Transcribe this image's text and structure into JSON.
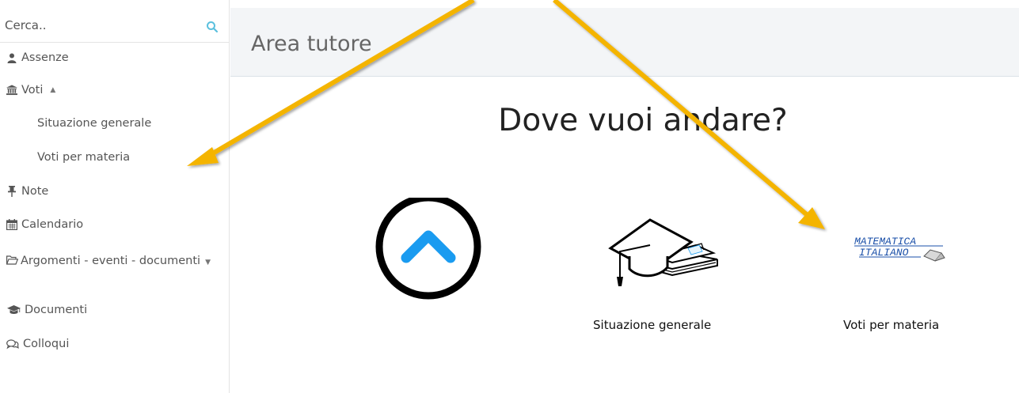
{
  "search": {
    "placeholder": "Cerca.."
  },
  "sidebar": {
    "items": [
      {
        "label": "Assenze",
        "icon": "user-icon"
      },
      {
        "label": "Voti",
        "icon": "bank-icon"
      },
      {
        "label": "Situazione generale"
      },
      {
        "label": "Voti per materia"
      },
      {
        "label": "Note",
        "icon": "pushpin-icon"
      },
      {
        "label": "Calendario",
        "icon": "calendar-icon"
      },
      {
        "label": "Argomenti - eventi - documenti",
        "icon": "folder-open-icon"
      },
      {
        "label": "Documenti",
        "icon": "graduation-cap-icon"
      },
      {
        "label": "Colloqui",
        "icon": "chat-bubbles-icon"
      }
    ]
  },
  "main": {
    "title": "Area tutore",
    "question": "Dove vuoi andare?",
    "cards": [
      {
        "label": "",
        "icon": "chevron-up-circle-icon"
      },
      {
        "label": "Situazione generale",
        "icon": "graduation-cap-books-icon"
      },
      {
        "label": "Voti per materia",
        "icon": "matematica-italiano-logo",
        "logo_text_1": "MATEMATICA",
        "logo_text_2": "ITALIANO"
      }
    ]
  },
  "colors": {
    "accent": "#1a9bf0",
    "arrow": "#f4b400",
    "search_icon": "#5bc0de",
    "header_band": "#f3f5f7"
  }
}
